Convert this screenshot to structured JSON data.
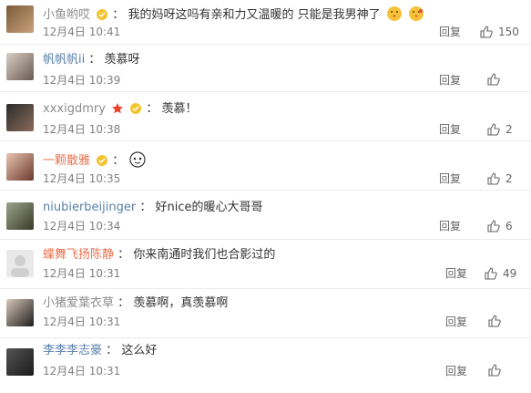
{
  "comments": [
    {
      "user": "小鱼哟哎",
      "text": "我的妈呀这吗有亲和力又温暖的 只能是我男神了",
      "time": "12月4日 10:41",
      "reply": "回复",
      "likes": "150"
    },
    {
      "user": "帆帆帆ii",
      "text": "羡慕呀",
      "time": "12月4日 10:39",
      "reply": "回复",
      "likes": ""
    },
    {
      "user": "xxxigdmry",
      "text": "羡慕！",
      "time": "12月4日 10:38",
      "reply": "回复",
      "likes": "2"
    },
    {
      "user": "一颗散雅",
      "text": "",
      "time": "12月4日 10:35",
      "reply": "回复",
      "likes": "2"
    },
    {
      "user": "niubierbeijinger",
      "text": "好nice的暖心大哥哥",
      "time": "12月4日 10:34",
      "reply": "回复",
      "likes": "6"
    },
    {
      "user": "蝶舞飞扬陈静",
      "text": "你来南通时我们也合影过的",
      "time": "12月4日 10:31",
      "reply": "回复",
      "likes": "49"
    },
    {
      "user": "小猪爱葉衣草",
      "text": "羡慕啊，真羡慕啊",
      "time": "12月4日 10:31",
      "reply": "回复",
      "likes": ""
    },
    {
      "user": "李李李志豪",
      "text": "这么好",
      "time": "12月4日 10:31",
      "reply": "回复",
      "likes": ""
    }
  ],
  "colors": {
    "username": "#eb7350",
    "separator": "#ececec"
  }
}
